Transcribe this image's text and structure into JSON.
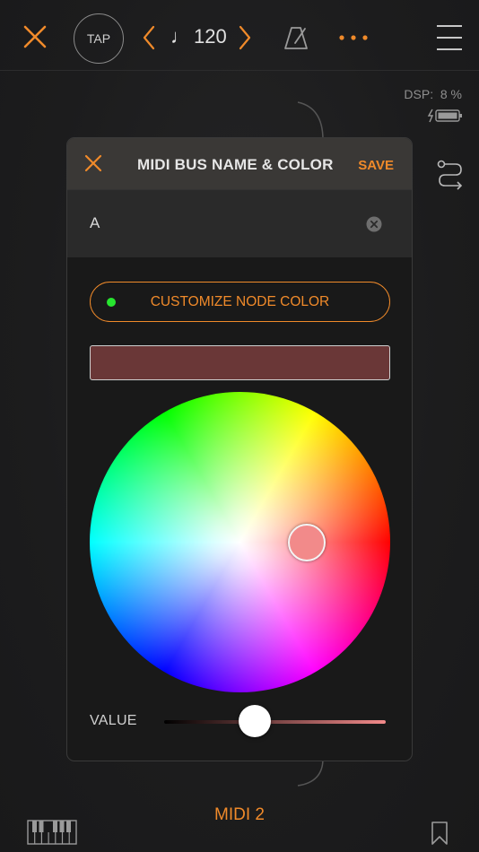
{
  "topbar": {
    "tap_label": "TAP",
    "tempo_note": "♩",
    "tempo_value": "120"
  },
  "status": {
    "dsp_label": "DSP:",
    "dsp_value": "8 %"
  },
  "modal": {
    "title": "MIDI BUS NAME & COLOR",
    "save_label": "SAVE",
    "name_value": "A",
    "customize_label": "CUSTOMIZE NODE COLOR",
    "customize_dot_color": "#27e52f",
    "selected_color": "#6a3737",
    "handle_color": "#f28a8a",
    "value_label": "VALUE",
    "value_level": 0.41
  },
  "bottom": {
    "bus_name": "MIDI 2"
  },
  "colors": {
    "accent": "#f08a2a",
    "background": "#1b1b1c"
  }
}
